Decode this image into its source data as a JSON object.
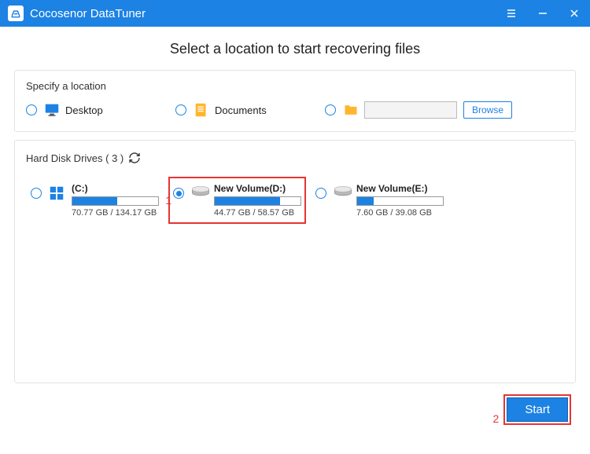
{
  "titlebar": {
    "title": "Cocosenor DataTuner"
  },
  "heading": "Select a location to start recovering files",
  "specify": {
    "label": "Specify a location",
    "desktop": "Desktop",
    "documents": "Documents",
    "browse": "Browse"
  },
  "drives": {
    "label": "Hard Disk Drives ( 3 )",
    "items": [
      {
        "name": "(C:)",
        "size": "70.77 GB / 134.17 GB",
        "fillPct": 52,
        "selected": false,
        "highlighted": false,
        "iconType": "win"
      },
      {
        "name": "New Volume(D:)",
        "size": "44.77 GB / 58.57 GB",
        "fillPct": 76,
        "selected": true,
        "highlighted": true,
        "iconType": "hdd"
      },
      {
        "name": "New Volume(E:)",
        "size": "7.60 GB / 39.08 GB",
        "fillPct": 19,
        "selected": false,
        "highlighted": false,
        "iconType": "hdd"
      }
    ]
  },
  "annotations": {
    "one": "1",
    "two": "2"
  },
  "footer": {
    "start": "Start"
  }
}
